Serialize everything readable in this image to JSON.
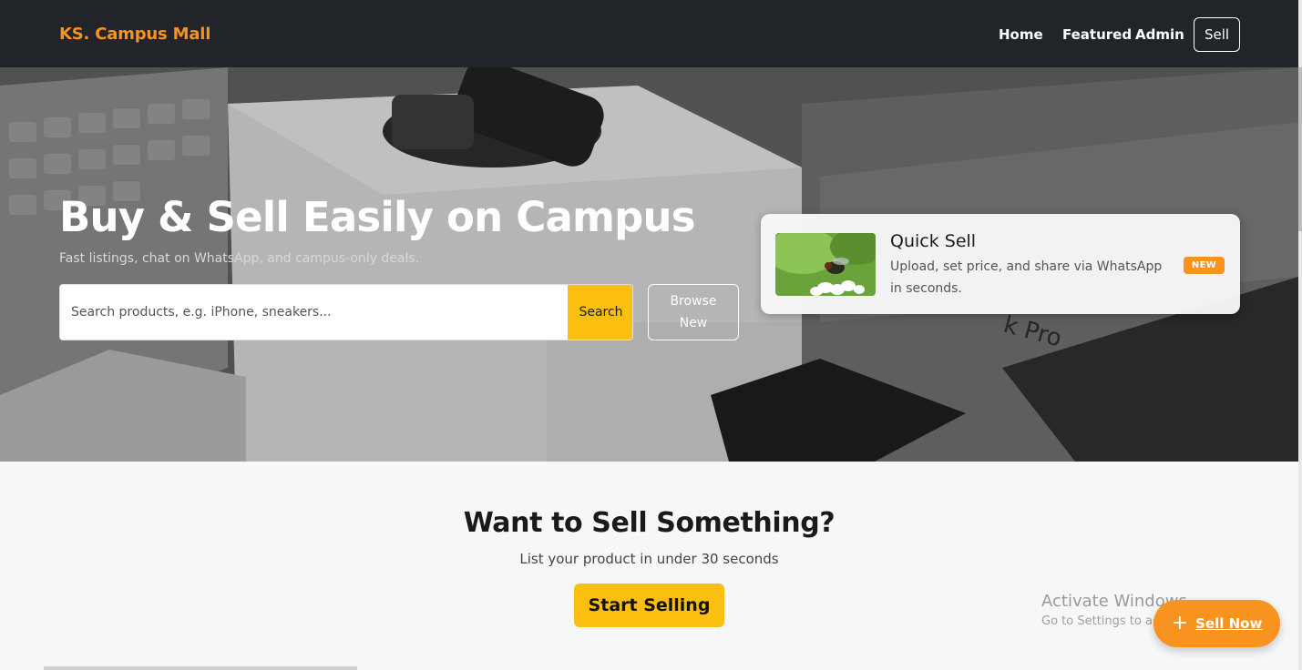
{
  "navbar": {
    "brand": "KS. Campus Mall",
    "links": [
      "Home",
      "Featured",
      "Admin"
    ],
    "sell_label": "Sell"
  },
  "hero": {
    "title": "Buy & Sell Easily on Campus",
    "subtitle": "Fast listings, chat on WhatsApp, and campus-only deals.",
    "search": {
      "placeholder": "Search products, e.g. iPhone, sneakers...",
      "value": "",
      "button_label": "Search"
    },
    "browse_label": "Browse New"
  },
  "quick_sell": {
    "title": "Quick Sell",
    "description": "Upload, set price, and share via WhatsApp in seconds.",
    "badge": "NEW"
  },
  "sell_section": {
    "title": "Want to Sell Something?",
    "subtitle": "List your product in under 30 seconds",
    "button_label": "Start Selling"
  },
  "fab": {
    "icon": "plus-icon",
    "label": "Sell Now"
  },
  "os_watermark": {
    "title": "Activate Windows",
    "subtitle": "Go to Settings to activate Windows."
  },
  "colors": {
    "navbar_bg": "#212529",
    "brand": "#f7931e",
    "accent_yellow": "#fbbf0f",
    "accent_orange": "#f7931e"
  }
}
